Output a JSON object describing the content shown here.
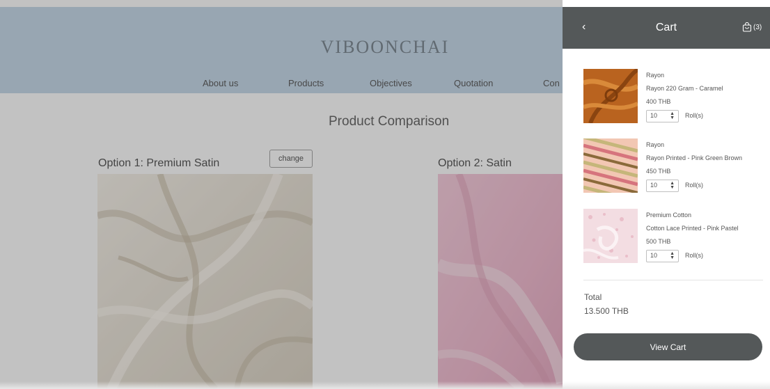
{
  "site": {
    "brand": "VIBOONCHAI",
    "nav": [
      "About us",
      "Products",
      "Objectives",
      "Quotation",
      "Con"
    ]
  },
  "comparison": {
    "heading": "Product Comparison",
    "option1": {
      "title": "Option 1: Premium Satin",
      "change_label": "change"
    },
    "option2": {
      "title": "Option 2: Satin"
    }
  },
  "cart": {
    "back_icon": "chevron-left-icon",
    "title": "Cart",
    "bag_icon": "shopping-bag-icon",
    "count": "(3)",
    "items": [
      {
        "category": "Rayon",
        "name": "Rayon 220 Gram - Caramel",
        "price": "400 THB",
        "qty": "10",
        "unit": "Roll(s)"
      },
      {
        "category": "Rayon",
        "name": "Rayon Printed - Pink Green Brown",
        "price": "450 THB",
        "qty": "10",
        "unit": "Roll(s)"
      },
      {
        "category": "Premium Cotton",
        "name": "Cotton Lace Printed - Pink Pastel",
        "price": "500 THB",
        "qty": "10",
        "unit": "Roll(s)"
      }
    ],
    "total_label": "Total",
    "total_value": "13.500 THB",
    "view_cart_label": "View Cart"
  },
  "colors": {
    "header_bg": "#c1d5e8",
    "cart_header_bg": "#545859",
    "overlay": "#464646",
    "caramel": "#b9631f",
    "satin": "#eee8dc",
    "pink_satin": "#f2b8cf"
  }
}
